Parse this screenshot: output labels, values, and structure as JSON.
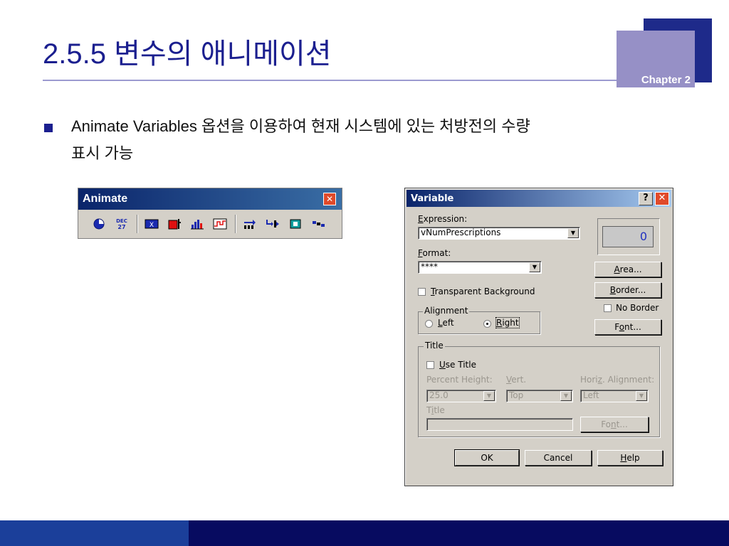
{
  "slide": {
    "title": "2.5.5 변수의 애니메이션",
    "chapter": "Chapter 2",
    "bullet_line1": "Animate Variables 옵션을 이용하여 현재 시스템에 있는 처방전의 수량",
    "bullet_line2": "표시 가능"
  },
  "colors": {
    "title_blue": "#1b1f8f",
    "chapter_dark": "#1e2a8a",
    "chapter_light": "#9690c6",
    "footer_light": "#1b3f9a",
    "footer_dark": "#070b60"
  },
  "toolbar": {
    "title": "Animate",
    "close": "✕",
    "buttons": [
      {
        "name": "clock-icon"
      },
      {
        "name": "date-icon",
        "text": "DEC 27"
      },
      {
        "name": "variable-icon",
        "text": "X"
      },
      {
        "name": "level-icon"
      },
      {
        "name": "histogram-icon"
      },
      {
        "name": "plot-icon"
      },
      {
        "name": "queue-icon"
      },
      {
        "name": "transfer-icon"
      },
      {
        "name": "global-icon"
      },
      {
        "name": "entities-icon"
      }
    ]
  },
  "dialog": {
    "title": "Variable",
    "help": "?",
    "close": "✕",
    "expression_label_ul": "E",
    "expression_label_rest": "xpression:",
    "expression_value": "vNumPrescriptions",
    "format_label_ul": "F",
    "format_label_rest": "ormat:",
    "format_value": "****",
    "preview_value": "0",
    "transparent_label_ul": "T",
    "transparent_label_rest": "ransparent Background",
    "alignment_label": "Alignment",
    "left_label_ul": "L",
    "left_label_rest": "eft",
    "right_label_ul": "R",
    "right_label_rest": "ight",
    "area_ul": "A",
    "area_rest": "rea...",
    "border_ul": "B",
    "border_rest": "order...",
    "no_border_label": "No Border",
    "font_pre": "F",
    "font_ul": "o",
    "font_rest": "nt...",
    "title_group_label": "Title",
    "use_title_ul": "U",
    "use_title_rest": "se Title",
    "percent_height_label": "Percent Height:",
    "vert_ul": "V",
    "vert_rest": "ert.",
    "horiz_pre": "Hori",
    "horiz_ul": "z",
    "horiz_rest": ". Alignment:",
    "percent_height_value": "25.0",
    "vert_value": "Top",
    "horiz_value": "Left",
    "title_field_pre": "T",
    "title_field_ul": "i",
    "title_field_rest": "tle",
    "title_value": "",
    "title_font_pre": "Fo",
    "title_font_ul": "n",
    "title_font_rest": "t...",
    "ok": "OK",
    "cancel": "Cancel",
    "help_ul": "H",
    "help_rest": "elp"
  }
}
